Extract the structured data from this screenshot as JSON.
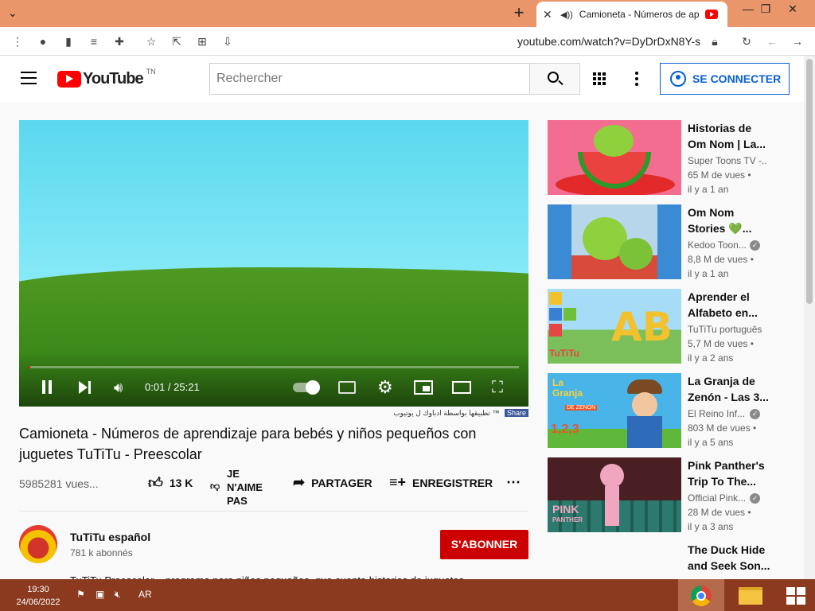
{
  "browser": {
    "tab_title": "Camioneta - Números de ap",
    "url": "youtube.com/watch?v=DyDrDxN8Y-s",
    "new_tab_glyph": "+",
    "min_glyph": "—",
    "max_glyph": "❐",
    "close_glyph": "✕"
  },
  "header": {
    "logo_text": "YouTube",
    "country": "TN",
    "search_placeholder": "Rechercher",
    "signin_label": "SE CONNECTER"
  },
  "player": {
    "time": "0:01 / 25:21",
    "progress": 0.0007
  },
  "share_bar": {
    "text": "تطبيقها بواسطة ادباوك ل يوتيوب ™",
    "share_label": "Share"
  },
  "video": {
    "title": "Camioneta - Números de aprendizaje para bebés y niños pequeños con juguetes TuTiTu - Preescolar",
    "views": "5985281 vues...",
    "likes": "13 K",
    "dislike_label": "JE N'AIME PAS",
    "share_label": "PARTAGER",
    "save_label": "ENREGISTRER",
    "description_peek": "TuTiTu Preescolar – programa para niños pequeños, que cuenta historias de juguetes"
  },
  "channel": {
    "name": "TuTiTu español",
    "subscribers": "781 k abonnés",
    "subscribe_label": "S'ABONNER"
  },
  "recommendations": [
    {
      "title": "Historias de Om Nom | La...",
      "channel": "Super Toons TV -...",
      "views": "65 M de vues •",
      "age": "il y a 1 an",
      "verified": false
    },
    {
      "title": "Om Nom Stories 💚...",
      "channel": "Kedoo Toon...",
      "views": "8,8 M de vues •",
      "age": "il y a 1 an",
      "verified": true
    },
    {
      "title": "Aprender el Alfabeto en...",
      "channel": "TuTiTu português",
      "views": "5,7 M de vues •",
      "age": "il y a 2 ans",
      "verified": false
    },
    {
      "title": "La Granja de Zenón - Las 3...",
      "channel": "El Reino Inf...",
      "views": "803 M de vues •",
      "age": "il y a 5 ans",
      "verified": true
    },
    {
      "title": "Pink Panther's Trip To The...",
      "channel": "Official Pink...",
      "views": "28 M de vues •",
      "age": "il y a 3 ans",
      "verified": true
    },
    {
      "title": "The Duck Hide and Seek Son...",
      "channel": "",
      "views": "",
      "age": "",
      "verified": false
    }
  ],
  "thumb_text": {
    "granja_line1": "La",
    "granja_line2": "Granja",
    "granja_sub": "DE ZENÓN",
    "granja_num": "1,2,3",
    "pink_line1": "PINK",
    "pink_line2": "PANTHER",
    "abc_letters": "AB",
    "abc_brand": "TuTiTu"
  },
  "taskbar": {
    "time": "19:30",
    "date": "24/06/2022",
    "lang": "AR"
  },
  "colors": {
    "accent_red": "#ff0000",
    "subscribe_red": "#cc0000",
    "link_blue": "#065fd4",
    "tabbar": "#e8966a",
    "taskbar": "#8b3a1f"
  }
}
